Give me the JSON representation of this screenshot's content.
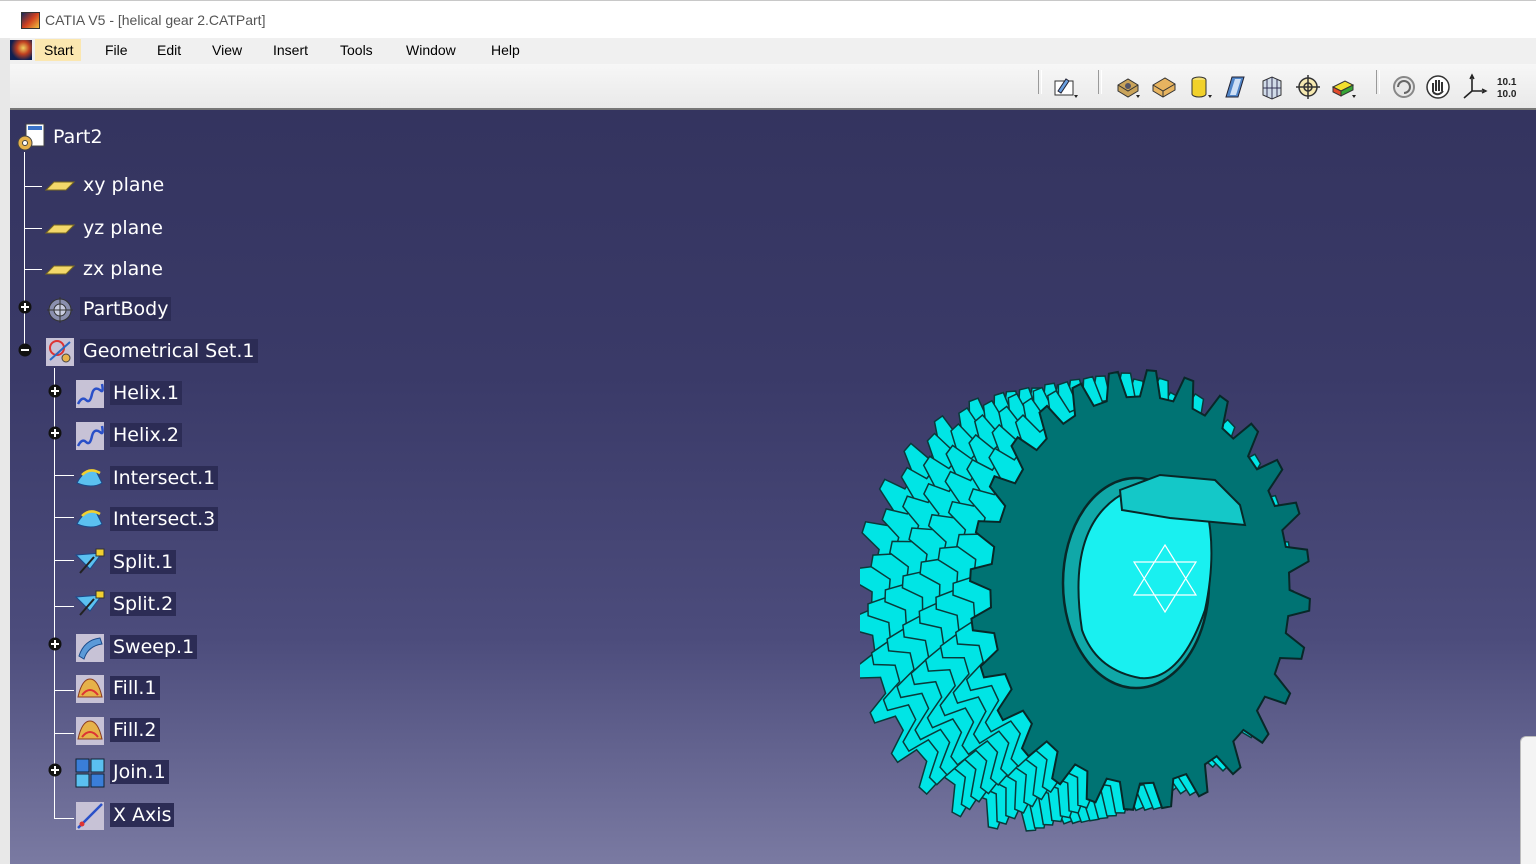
{
  "window": {
    "title": "CATIA V5 - [helical gear 2.CATPart]"
  },
  "menubar": {
    "items": [
      {
        "label": "Start",
        "active": true
      },
      {
        "label": "File"
      },
      {
        "label": "Edit"
      },
      {
        "label": "View"
      },
      {
        "label": "Insert"
      },
      {
        "label": "Tools"
      },
      {
        "label": "Window"
      },
      {
        "label": "Help"
      }
    ]
  },
  "toolbar": {
    "buttons": [
      {
        "icon": "sketch-icon"
      },
      {
        "icon": "pad-icon"
      },
      {
        "icon": "shaded-edges-icon"
      },
      {
        "icon": "cylinder-icon"
      },
      {
        "icon": "parallelogram-icon"
      },
      {
        "icon": "multi-view-icon"
      },
      {
        "icon": "target-icon"
      },
      {
        "icon": "hide-show-icon"
      },
      {
        "icon": "rotate-icon"
      },
      {
        "icon": "pan-hand-icon"
      },
      {
        "icon": "axis-system-icon"
      },
      {
        "icon": "units-table-icon",
        "text": "10.1 10.0"
      }
    ]
  },
  "tree": {
    "root": {
      "label": "Part2",
      "icon": "part-icon"
    },
    "nodes": [
      {
        "label": "xy plane",
        "icon": "plane-icon"
      },
      {
        "label": "yz plane",
        "icon": "plane-icon"
      },
      {
        "label": "zx plane",
        "icon": "plane-icon"
      },
      {
        "label": "PartBody",
        "icon": "part-body-icon",
        "expander": "plus"
      },
      {
        "label": "Geometrical Set.1",
        "icon": "geometrical-set-icon",
        "expander": "minus"
      },
      {
        "label": "Helix.1",
        "icon": "helix-icon",
        "expander": "plus"
      },
      {
        "label": "Helix.2",
        "icon": "helix-icon",
        "expander": "plus"
      },
      {
        "label": "Intersect.1",
        "icon": "intersect-icon"
      },
      {
        "label": "Intersect.3",
        "icon": "intersect-icon"
      },
      {
        "label": "Split.1",
        "icon": "split-icon"
      },
      {
        "label": "Split.2",
        "icon": "split-icon"
      },
      {
        "label": "Sweep.1",
        "icon": "sweep-icon",
        "expander": "plus"
      },
      {
        "label": "Fill.1",
        "icon": "fill-icon"
      },
      {
        "label": "Fill.2",
        "icon": "fill-icon"
      },
      {
        "label": "Join.1",
        "icon": "join-icon",
        "expander": "plus"
      },
      {
        "label": "X Axis",
        "icon": "line-icon"
      }
    ]
  },
  "model": {
    "name": "helical gear",
    "teeth": 28,
    "color_face": "#007373",
    "color_teeth": "#00e5e5",
    "color_bore": "#19f0f0"
  },
  "colors": {
    "viewport_top": "#34345f",
    "viewport_bottom": "#7a7aa2",
    "selected_label_bg": "#2c2c55",
    "active_menu": "#fbe7b0"
  }
}
